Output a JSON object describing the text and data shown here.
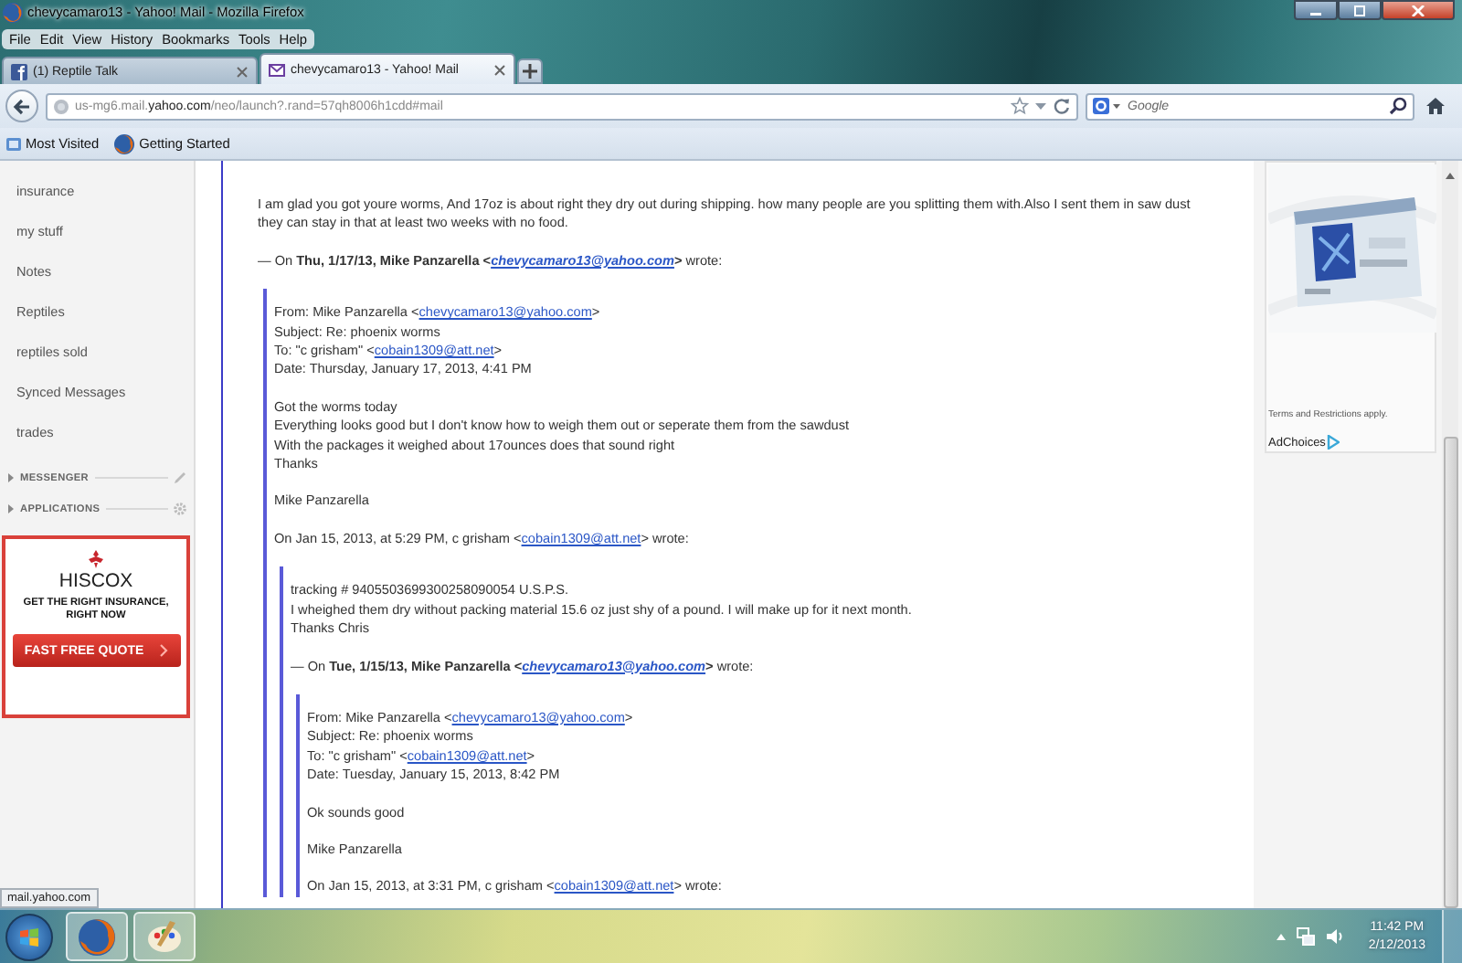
{
  "window": {
    "title": "chevycamaro13 - Yahoo! Mail - Mozilla Firefox"
  },
  "menu": [
    "File",
    "Edit",
    "View",
    "History",
    "Bookmarks",
    "Tools",
    "Help"
  ],
  "tabs": [
    {
      "label": "(1) Reptile Talk",
      "selected": false
    },
    {
      "label": "chevycamaro13 - Yahoo! Mail",
      "selected": true
    }
  ],
  "address_bar": {
    "value": "us-mg6.mail.**yahoo.com**/neo/launch?.rand=57qh8006h1cdd#mail"
  },
  "search": {
    "placeholder": "Google"
  },
  "bookmarks": [
    "Most Visited",
    "Getting Started"
  ],
  "sidebar": {
    "folders": [
      "insurance",
      "my stuff",
      "Notes",
      "Reptiles",
      "reptiles sold",
      "Synced Messages",
      "trades"
    ],
    "sections": [
      {
        "label": "MESSENGER",
        "expanded": false
      },
      {
        "label": "APPLICATIONS",
        "expanded": false
      }
    ],
    "ad": {
      "brand": "HISCOX",
      "headline_lines": [
        "GET THE RIGHT INSURANCE,",
        "RIGHT NOW"
      ],
      "button": "FAST FREE QUOTE"
    }
  },
  "message": {
    "blocks": [
      {
        "kind": "text",
        "lines": [
          "I am glad you got youre worms, And 17oz is about right they dry out during shipping. how many people are you splitting them with.Also I sent them in saw dust they can stay in that at least two weeks with no food."
        ]
      },
      {
        "kind": "text",
        "lines": [
          {
            "before": "— On **Thu, 1/17/13, Mike Panzarella <**",
            "link": "chevycamaro13@yahoo.com",
            "after": "**>** wrote:",
            "strong_link": true
          }
        ]
      },
      {
        "kind": "quote",
        "children": [
          {
            "kind": "text",
            "lines": [
              {
                "before": "From: Mike Panzarella <",
                "link": "chevycamaro13@yahoo.com",
                "after": ">",
                "strong_link": false
              },
              "Subject: Re: phoenix worms",
              {
                "before": "To: \"c grisham\" <",
                "link": "cobain1309@att.net",
                "after": ">",
                "strong_link": false
              },
              "Date: Thursday, January 17, 2013, 4:41 PM"
            ]
          },
          {
            "kind": "text",
            "lines": [
              "Got the worms today",
              "Everything looks good but I don't know how to weigh them out or seperate them from the sawdust",
              "With the packages it weighed about 17ounces does that sound right",
              "Thanks"
            ]
          },
          {
            "kind": "text",
            "lines": [
              "Mike Panzarella"
            ]
          },
          {
            "kind": "text",
            "lines": [
              {
                "before": "On Jan 15, 2013, at 5:29 PM, c grisham <",
                "link": "cobain1309@att.net",
                "after": "> wrote:",
                "strong_link": false
              }
            ]
          },
          {
            "kind": "quote",
            "children": [
              {
                "kind": "text",
                "lines": [
                  "tracking # 9405503699300258090054  U.S.P.S.",
                  "I wheighed them dry without packing material 15.6 oz just shy of a pound. I will make up for it next month.",
                  "Thanks Chris"
                ]
              },
              {
                "kind": "text",
                "lines": [
                  {
                    "before": "— On **Tue, 1/15/13, Mike Panzarella <**",
                    "link": "chevycamaro13@yahoo.com",
                    "after": "**>** wrote:",
                    "strong_link": true
                  }
                ]
              },
              {
                "kind": "quote",
                "children": [
                  {
                    "kind": "text",
                    "lines": [
                      {
                        "before": "From: Mike Panzarella <",
                        "link": "chevycamaro13@yahoo.com",
                        "after": ">",
                        "strong_link": false
                      },
                      "Subject: Re: phoenix worms",
                      {
                        "before": "To: \"c grisham\" <",
                        "link": "cobain1309@att.net",
                        "after": ">",
                        "strong_link": false
                      },
                      "Date: Tuesday, January 15, 2013, 8:42 PM"
                    ]
                  },
                  {
                    "kind": "text",
                    "lines": [
                      "Ok sounds good"
                    ]
                  },
                  {
                    "kind": "text",
                    "lines": [
                      "Mike Panzarella"
                    ]
                  },
                  {
                    "kind": "text",
                    "lines": [
                      {
                        "before": "On Jan 15, 2013, at 3:31 PM, c grisham <",
                        "link": "cobain1309@att.net",
                        "after": "> wrote:",
                        "strong_link": false
                      }
                    ]
                  }
                ]
              }
            ]
          }
        ]
      }
    ]
  },
  "right_ad": {
    "terms": "Terms and Restrictions apply.",
    "ad_choices": "AdChoices"
  },
  "status_tooltip": "mail.yahoo.com",
  "taskbar": {
    "time": "11:42 PM",
    "date": "2/12/2013"
  }
}
